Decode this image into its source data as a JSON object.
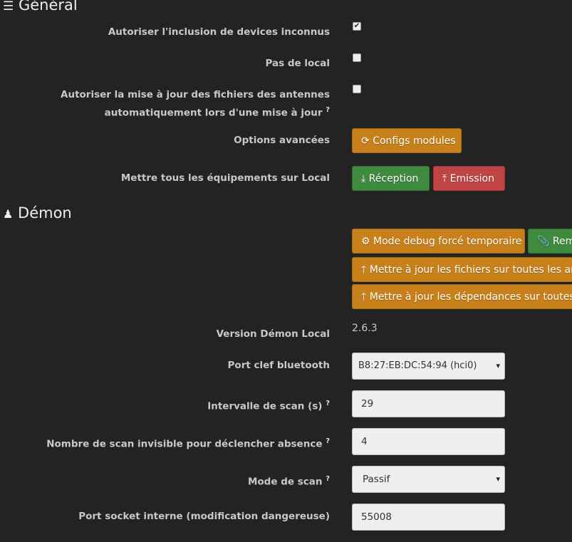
{
  "general": {
    "title": "Général",
    "rows": {
      "unknown": "Autoriser l'inclusion de devices inconnus",
      "nolocal": "Pas de local",
      "autoupdate1": "Autoriser la mise à jour des fichiers des antennes",
      "autoupdate2": "automatiquement lors d'une mise à jour",
      "advanced": "Options avancées",
      "alllocal": "Mettre tous les équipements sur Local"
    },
    "checks": {
      "unknown": true,
      "nolocal": false,
      "autoupdate": false
    },
    "buttons": {
      "configs": "Configs modules",
      "reception": "Réception",
      "emission": "Emission"
    }
  },
  "demon": {
    "title": "Démon",
    "buttons": {
      "debug": "Mode debug forcé temporaire",
      "remote": "Remettre",
      "files": "Mettre à jour les fichiers sur toutes les antennes",
      "deps": "Mettre à jour les dépendances sur toutes les antennes"
    },
    "labels": {
      "version": "Version Démon Local",
      "port": "Port clef bluetooth",
      "interval": "Intervalle de scan (s)",
      "invisible": "Nombre de scan invisible pour déclencher absence",
      "mode": "Mode de scan",
      "socket": "Port socket interne (modification dangereuse)"
    },
    "values": {
      "version": "2.6.3",
      "port": "B8:27:EB:DC:54:94 (hci0)",
      "interval": "29",
      "invisible": "4",
      "mode": "Passif",
      "socket": "55008"
    }
  }
}
